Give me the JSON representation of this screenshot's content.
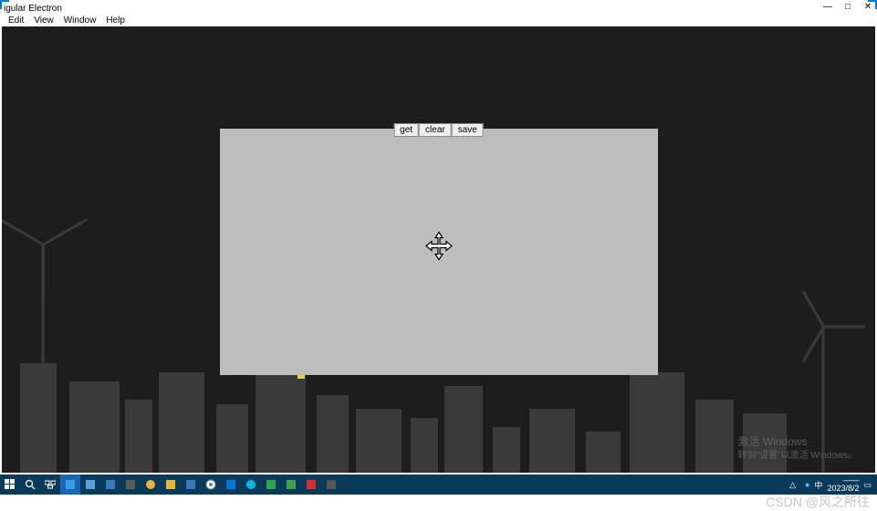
{
  "window": {
    "title": "igular Electron",
    "controls": {
      "min": "—",
      "max": "□",
      "close": "✕"
    }
  },
  "menubar": {
    "items": [
      "Edit",
      "View",
      "Window",
      "Help"
    ]
  },
  "toolbar": {
    "get_label": "get",
    "clear_label": "clear",
    "save_label": "save"
  },
  "watermark": {
    "line1": "激活 Windows",
    "line2": "转到\"设置\"以激活 Windows。"
  },
  "csdn": "CSDN @风之所往",
  "taskbar": {
    "clock_time": "——",
    "clock_date": "2023/8/2",
    "input_indicator": "中",
    "tray": [
      "△",
      "●",
      "●",
      "▣"
    ],
    "apps": []
  },
  "icons": {
    "start": "start-icon",
    "search": "search-icon",
    "taskview": "task-view-icon"
  },
  "colors": {
    "taskbar": "#0a3a5a",
    "app_bg": "#1d1d1d",
    "canvas": "#bdbdbd",
    "silhouette": "#3a3a3a",
    "windlight": "#e8d23a",
    "accent": "#0078d7"
  }
}
